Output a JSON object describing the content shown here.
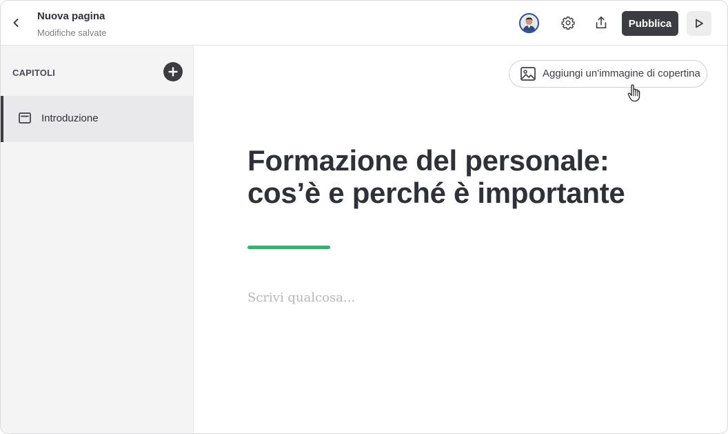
{
  "header": {
    "page_name": "Nuova pagina",
    "save_status": "Modifiche salvate",
    "publish_label": "Pubblica",
    "icons": {
      "back": "chevron-left-icon",
      "settings": "gear-icon",
      "share": "share-upload-icon",
      "preview": "play-icon"
    }
  },
  "sidebar": {
    "section_label": "CAPITOLI",
    "add_icon": "plus-circle-icon",
    "chapters": [
      {
        "label": "Introduzione",
        "icon": "chapter-page-icon",
        "active": true
      }
    ]
  },
  "editor": {
    "cover_button_label": "Aggiungi un'immagine di copertina",
    "cover_icon": "image-icon",
    "title_line1": "Formazione del personale:",
    "title_line2": "cos’è e perché è importante",
    "body_placeholder": "Scrivi qualcosa..."
  },
  "colors": {
    "accent": "#3aae6a",
    "dark_button": "#3b3d43",
    "sidebar_bg": "#f4f4f5"
  }
}
